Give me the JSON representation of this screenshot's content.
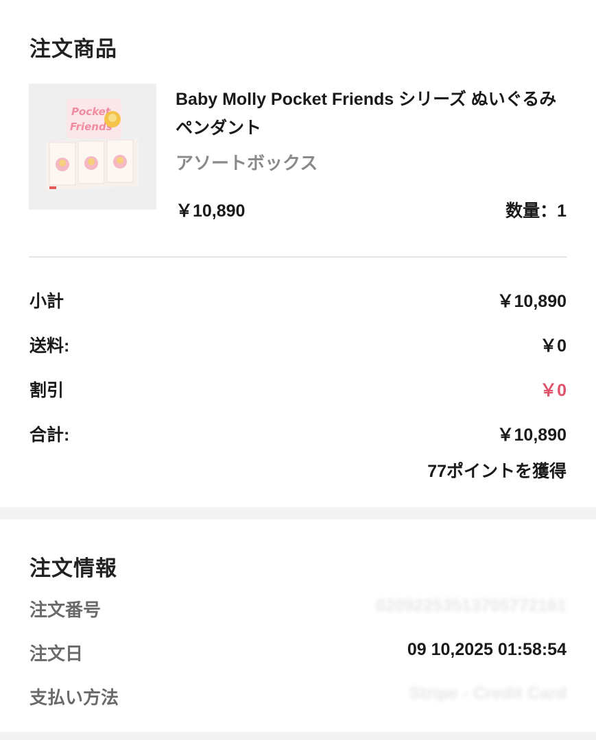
{
  "order_items_section": {
    "title": "注文商品",
    "product": {
      "name": "Baby Molly Pocket Friends シリーズ ぬいぐるみペンダント",
      "variant": "アソートボックス",
      "price": "￥10,890",
      "quantity": "数量：1",
      "image_icon": "product-box-image"
    }
  },
  "summary": {
    "subtotal_label": "小計",
    "subtotal_value": "￥10,890",
    "shipping_label": "送料:",
    "shipping_value": "￥0",
    "discount_label": "割引",
    "discount_value": "￥0",
    "total_label": "合計:",
    "total_value": "￥10,890",
    "points_text": "77ポイントを獲得"
  },
  "order_info_section": {
    "title": "注文情報",
    "order_number_label": "注文番号",
    "order_number_value": "02092253513705772161",
    "order_date_label": "注文日",
    "order_date_value": "09 10,2025 01:58:54",
    "payment_label": "支払い方法",
    "payment_value": "Stripe - Credit Card"
  },
  "colors": {
    "discount": "#e0546b",
    "muted_label": "#6a6a6a",
    "variant_text": "#8a8a8a",
    "separator_band": "#f3f3f3"
  }
}
